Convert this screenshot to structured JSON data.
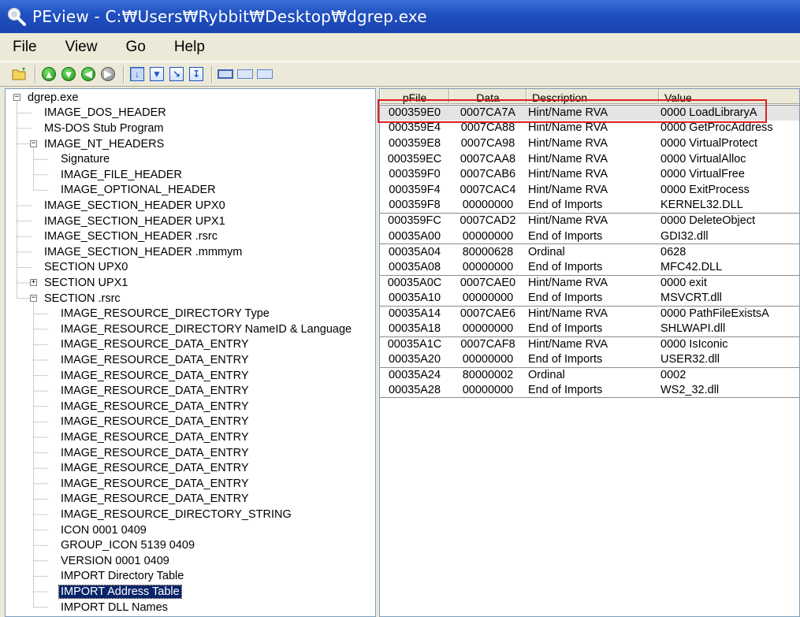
{
  "window": {
    "title": "PEview - C:₩Users₩Rybbit₩Desktop₩dgrep.exe"
  },
  "menu": [
    "File",
    "View",
    "Go",
    "Help"
  ],
  "toolbar": {
    "buttons": [
      "open-icon",
      "back-icon",
      "forward-icon",
      "up-icon",
      "down-icon",
      "disabled-nav-icon",
      "view-byte-icon",
      "view-word-icon",
      "view-dword-icon",
      "view-section-icon",
      "view-detail-icon",
      "view-list-icon",
      "view-small-icon"
    ]
  },
  "tree": {
    "items": [
      {
        "label": "dgrep.exe",
        "level": 0,
        "expander": "minus"
      },
      {
        "label": "IMAGE_DOS_HEADER",
        "level": 1
      },
      {
        "label": "MS-DOS Stub Program",
        "level": 1
      },
      {
        "label": "IMAGE_NT_HEADERS",
        "level": 1,
        "expander": "minus"
      },
      {
        "label": "Signature",
        "level": 2
      },
      {
        "label": "IMAGE_FILE_HEADER",
        "level": 2
      },
      {
        "label": "IMAGE_OPTIONAL_HEADER",
        "level": 2
      },
      {
        "label": "IMAGE_SECTION_HEADER UPX0",
        "level": 1
      },
      {
        "label": "IMAGE_SECTION_HEADER UPX1",
        "level": 1
      },
      {
        "label": "IMAGE_SECTION_HEADER .rsrc",
        "level": 1
      },
      {
        "label": "IMAGE_SECTION_HEADER .mmmym",
        "level": 1
      },
      {
        "label": "SECTION UPX0",
        "level": 1
      },
      {
        "label": "SECTION UPX1",
        "level": 1,
        "expander": "plus"
      },
      {
        "label": "SECTION .rsrc",
        "level": 1,
        "expander": "minus"
      },
      {
        "label": "IMAGE_RESOURCE_DIRECTORY Type",
        "level": 2
      },
      {
        "label": "IMAGE_RESOURCE_DIRECTORY NameID & Language",
        "level": 2
      },
      {
        "label": "IMAGE_RESOURCE_DATA_ENTRY",
        "level": 2
      },
      {
        "label": "IMAGE_RESOURCE_DATA_ENTRY",
        "level": 2
      },
      {
        "label": "IMAGE_RESOURCE_DATA_ENTRY",
        "level": 2
      },
      {
        "label": "IMAGE_RESOURCE_DATA_ENTRY",
        "level": 2
      },
      {
        "label": "IMAGE_RESOURCE_DATA_ENTRY",
        "level": 2
      },
      {
        "label": "IMAGE_RESOURCE_DATA_ENTRY",
        "level": 2
      },
      {
        "label": "IMAGE_RESOURCE_DATA_ENTRY",
        "level": 2
      },
      {
        "label": "IMAGE_RESOURCE_DATA_ENTRY",
        "level": 2
      },
      {
        "label": "IMAGE_RESOURCE_DATA_ENTRY",
        "level": 2
      },
      {
        "label": "IMAGE_RESOURCE_DATA_ENTRY",
        "level": 2
      },
      {
        "label": "IMAGE_RESOURCE_DATA_ENTRY",
        "level": 2
      },
      {
        "label": "IMAGE_RESOURCE_DIRECTORY_STRING",
        "level": 2
      },
      {
        "label": "ICON  0001  0409",
        "level": 2
      },
      {
        "label": "GROUP_ICON  5139  0409",
        "level": 2
      },
      {
        "label": "VERSION  0001  0409",
        "level": 2
      },
      {
        "label": "IMPORT Directory Table",
        "level": 2
      },
      {
        "label": "IMPORT Address Table",
        "level": 2,
        "selected": true
      },
      {
        "label": "IMPORT DLL Names",
        "level": 2
      }
    ]
  },
  "list": {
    "columns": [
      "pFile",
      "Data",
      "Description",
      "Value"
    ],
    "rows": [
      {
        "pfile": "000359E0",
        "data": "0007CA7A",
        "desc": "Hint/Name RVA",
        "value": "0000  LoadLibraryA",
        "group_start": true,
        "highlight": true
      },
      {
        "pfile": "000359E4",
        "data": "0007CA88",
        "desc": "Hint/Name RVA",
        "value": "0000  GetProcAddress"
      },
      {
        "pfile": "000359E8",
        "data": "0007CA98",
        "desc": "Hint/Name RVA",
        "value": "0000  VirtualProtect"
      },
      {
        "pfile": "000359EC",
        "data": "0007CAA8",
        "desc": "Hint/Name RVA",
        "value": "0000  VirtualAlloc"
      },
      {
        "pfile": "000359F0",
        "data": "0007CAB6",
        "desc": "Hint/Name RVA",
        "value": "0000  VirtualFree"
      },
      {
        "pfile": "000359F4",
        "data": "0007CAC4",
        "desc": "Hint/Name RVA",
        "value": "0000  ExitProcess"
      },
      {
        "pfile": "000359F8",
        "data": "00000000",
        "desc": "End of Imports",
        "value": "KERNEL32.DLL"
      },
      {
        "pfile": "000359FC",
        "data": "0007CAD2",
        "desc": "Hint/Name RVA",
        "value": "0000  DeleteObject",
        "group_start": true
      },
      {
        "pfile": "00035A00",
        "data": "00000000",
        "desc": "End of Imports",
        "value": "GDI32.dll"
      },
      {
        "pfile": "00035A04",
        "data": "80000628",
        "desc": "Ordinal",
        "value": "0628",
        "group_start": true
      },
      {
        "pfile": "00035A08",
        "data": "00000000",
        "desc": "End of Imports",
        "value": "MFC42.DLL"
      },
      {
        "pfile": "00035A0C",
        "data": "0007CAE0",
        "desc": "Hint/Name RVA",
        "value": "0000  exit",
        "group_start": true
      },
      {
        "pfile": "00035A10",
        "data": "00000000",
        "desc": "End of Imports",
        "value": "MSVCRT.dll"
      },
      {
        "pfile": "00035A14",
        "data": "0007CAE6",
        "desc": "Hint/Name RVA",
        "value": "0000  PathFileExistsA",
        "group_start": true
      },
      {
        "pfile": "00035A18",
        "data": "00000000",
        "desc": "End of Imports",
        "value": "SHLWAPI.dll"
      },
      {
        "pfile": "00035A1C",
        "data": "0007CAF8",
        "desc": "Hint/Name RVA",
        "value": "0000  IsIconic",
        "group_start": true
      },
      {
        "pfile": "00035A20",
        "data": "00000000",
        "desc": "End of Imports",
        "value": "USER32.dll"
      },
      {
        "pfile": "00035A24",
        "data": "80000002",
        "desc": "Ordinal",
        "value": "0002",
        "group_start": true
      },
      {
        "pfile": "00035A28",
        "data": "00000000",
        "desc": "End of Imports",
        "value": "WS2_32.dll",
        "group_end": true
      }
    ]
  },
  "colors": {
    "titlebar": "#1f4fbf",
    "selection": "#0a246a",
    "annotation": "#e02020"
  }
}
